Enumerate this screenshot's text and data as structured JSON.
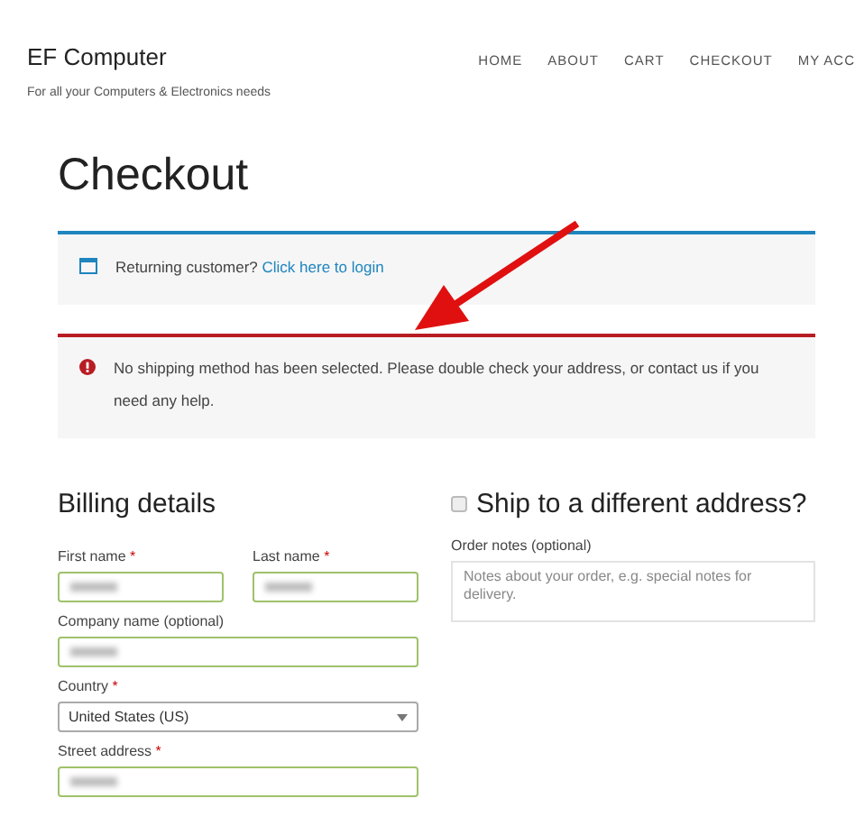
{
  "site": {
    "title": "EF Computer",
    "tagline": "For all your Computers & Electronics needs"
  },
  "nav": [
    {
      "label": "HOME"
    },
    {
      "label": "ABOUT"
    },
    {
      "label": "CART"
    },
    {
      "label": "CHECKOUT"
    },
    {
      "label": "MY ACC"
    }
  ],
  "page_title": "Checkout",
  "notices": [
    {
      "kind": "info",
      "text": "Returning customer? ",
      "link": "Click here to login"
    },
    {
      "kind": "error",
      "text": "No shipping method has been selected. Please double check your address, or contact us if you need any help."
    }
  ],
  "billing": {
    "title": "Billing details",
    "rows": [
      [
        {
          "kind": "text",
          "label": "First name",
          "required_mark": "*",
          "redacted": true
        },
        {
          "kind": "text",
          "label": "Last name",
          "required_mark": "*",
          "redacted": true
        }
      ],
      [
        {
          "kind": "text",
          "label": "Company name (optional)",
          "redacted": true
        }
      ],
      [
        {
          "kind": "select",
          "label": "Country",
          "required_mark": "*",
          "value": "United States (US)"
        }
      ],
      [
        {
          "kind": "text",
          "label": "Street address",
          "required_mark": "*",
          "redacted": true
        }
      ]
    ]
  },
  "shipping": {
    "title": "Ship to a different address?",
    "checked": false,
    "notes_label": "Order notes (optional)",
    "notes_placeholder": "Notes about your order, e.g. special notes for delivery."
  }
}
